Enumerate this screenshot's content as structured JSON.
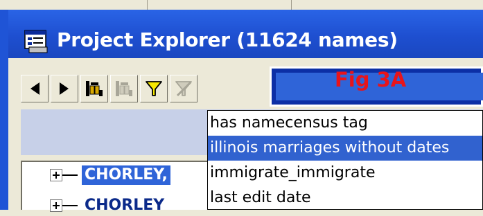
{
  "window": {
    "title": "Project Explorer (11624 names)"
  },
  "toolbar": {
    "buttons": [
      {
        "icon": "arrow-left-icon"
      },
      {
        "icon": "arrow-right-icon"
      },
      {
        "icon": "find-binoculars-icon"
      },
      {
        "icon": "find-binoculars-disabled-icon"
      },
      {
        "icon": "filter-funnel-icon"
      },
      {
        "icon": "filter-clear-icon"
      }
    ]
  },
  "annotation": {
    "fig_label": "Fig 3A",
    "color": "#e8141a"
  },
  "tree": {
    "rows": [
      {
        "label": "CHORLEY,"
      },
      {
        "label": "CHORLEY"
      }
    ]
  },
  "filter_dropdown": {
    "options": [
      {
        "label": "has namecensus tag",
        "selected": false
      },
      {
        "label": "illinois marriages without dates",
        "selected": true
      },
      {
        "label": "immigrate_immigrate",
        "selected": false
      },
      {
        "label": "last edit date",
        "selected": false
      }
    ]
  },
  "colors": {
    "titlebar": "#1e4fd0",
    "selection": "#3162cf",
    "face": "#ece9d8"
  }
}
